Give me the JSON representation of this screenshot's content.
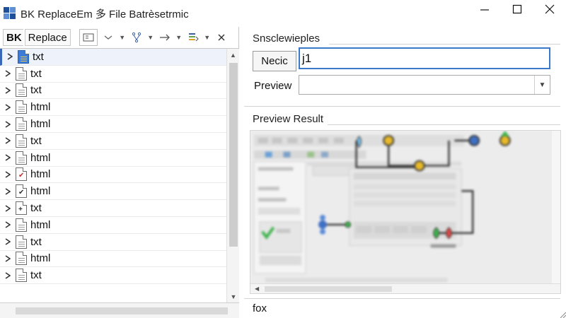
{
  "window": {
    "title": "BK ReplaceEm 多 File Batrèsetrmic",
    "controls": [
      "minimize",
      "maximize",
      "close"
    ]
  },
  "toolbar": {
    "brand_label": "BK",
    "replace_label": "Replace",
    "icons": [
      "view-icon",
      "filter-icon",
      "branch-icon",
      "arrow-right-icon",
      "stack-icon",
      "close-icon"
    ]
  },
  "file_tree": {
    "items": [
      {
        "label": "txt",
        "icon": "folder-file-icon"
      },
      {
        "label": "txt",
        "icon": "file-icon"
      },
      {
        "label": "txt",
        "icon": "file-icon"
      },
      {
        "label": "html",
        "icon": "file-icon"
      },
      {
        "label": "html",
        "icon": "file-icon"
      },
      {
        "label": "txt",
        "icon": "file-icon"
      },
      {
        "label": "html",
        "icon": "file-icon"
      },
      {
        "label": "html",
        "icon": "file-error-icon"
      },
      {
        "label": "html",
        "icon": "file-check-icon"
      },
      {
        "label": "txt",
        "icon": "file-add-icon"
      },
      {
        "label": "html",
        "icon": "file-icon"
      },
      {
        "label": "txt",
        "icon": "file-icon"
      },
      {
        "label": "html",
        "icon": "file-icon"
      },
      {
        "label": "txt",
        "icon": "file-icon"
      }
    ]
  },
  "settings": {
    "group_title": "Snsclewieples",
    "field_button_label": "Necic",
    "field_value": "j1",
    "preview_label": "Preview",
    "preview_value": ""
  },
  "preview_result": {
    "title": "Preview Result",
    "footer_text": "fox"
  },
  "colors": {
    "accent": "#3a78c9",
    "node_yellow": "#e8b92a",
    "node_blue": "#3f6fc4",
    "node_green": "#3fb24d",
    "node_red": "#d94848"
  }
}
